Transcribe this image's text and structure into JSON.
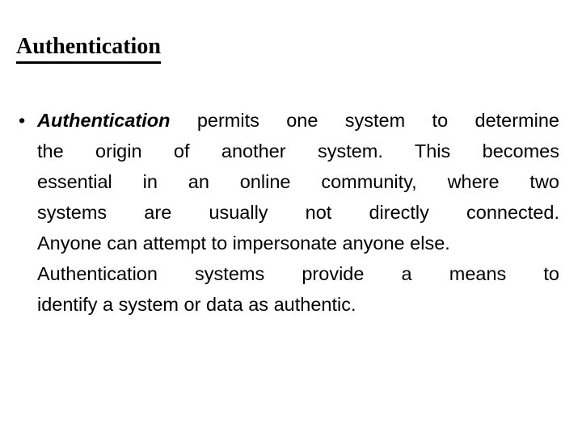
{
  "slide": {
    "title": "Authentication",
    "bullet_marker": "•",
    "body": {
      "lead_term": "Authentication",
      "full_text": "Authentication permits one system to determine the origin of another system. This becomes essential in an online community, where two systems are usually not directly connected. Anyone can attempt to impersonate anyone else. Authentication systems provide a means to identify a system or data as authentic.",
      "lines": [
        {
          "lead": "Authentication",
          "rest": " permits one system to determine",
          "justified": true
        },
        {
          "lead": "",
          "rest": "the origin of another system. This becomes",
          "justified": true
        },
        {
          "lead": "",
          "rest": "essential in an online community, where two",
          "justified": true
        },
        {
          "lead": "",
          "rest": "systems are usually not directly connected.",
          "justified": true
        },
        {
          "lead": "",
          "rest": "Anyone can attempt to impersonate anyone else.",
          "justified": false
        },
        {
          "lead": "",
          "rest": "Authentication systems provide a means to",
          "justified": true
        },
        {
          "lead": "",
          "rest": "identify a system or data as authentic.",
          "justified": false
        }
      ]
    }
  },
  "colors": {
    "background": "#ffffff",
    "text": "#000000",
    "title_underline": "#000000"
  }
}
